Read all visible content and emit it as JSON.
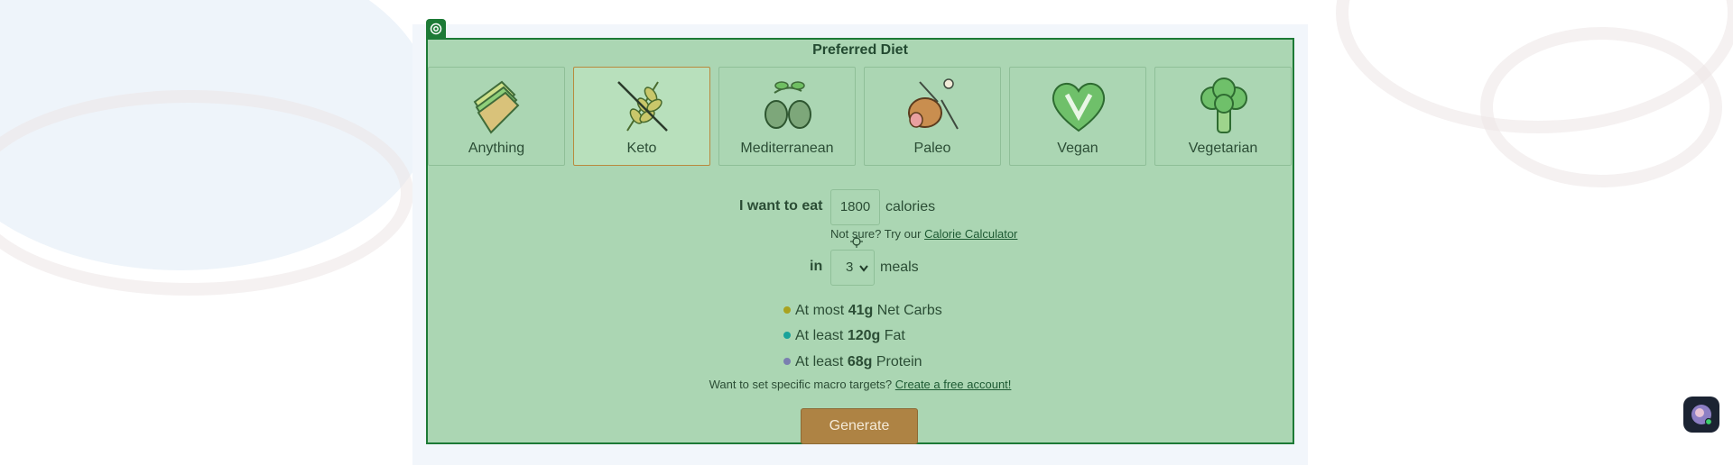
{
  "card": {
    "title": "Preferred Diet"
  },
  "diets": [
    {
      "label": "Anything",
      "icon": "sandwich-icon",
      "selected": false
    },
    {
      "label": "Keto",
      "icon": "crossed-wheat-icon",
      "selected": true
    },
    {
      "label": "Mediterranean",
      "icon": "olives-icon",
      "selected": false
    },
    {
      "label": "Paleo",
      "icon": "drumstick-icon",
      "selected": false
    },
    {
      "label": "Vegan",
      "icon": "heart-v-icon",
      "selected": false
    },
    {
      "label": "Vegetarian",
      "icon": "broccoli-icon",
      "selected": false
    }
  ],
  "calories": {
    "prefix": "I want to eat",
    "value": "1800",
    "suffix": "calories",
    "hint_prefix": "Not sure? Try our",
    "hint_link": "Calorie Calculator"
  },
  "meals": {
    "prefix": "in",
    "value": "3",
    "suffix": "meals"
  },
  "macros": [
    {
      "lead": "At most",
      "amount": "41g",
      "name": "Net Carbs",
      "color": "#a9a21f"
    },
    {
      "lead": "At least",
      "amount": "120g",
      "name": "Fat",
      "color": "#1aa39a"
    },
    {
      "lead": "At least",
      "amount": "68g",
      "name": "Protein",
      "color": "#7a7fb0"
    }
  ],
  "macro_note": {
    "text": "Want to set specific macro targets?",
    "link": "Create a free account!"
  },
  "generate_label": "Generate",
  "colors": {
    "card_bg": "#abd6b3",
    "card_border": "#1d7a36",
    "button": "#ae8344"
  }
}
